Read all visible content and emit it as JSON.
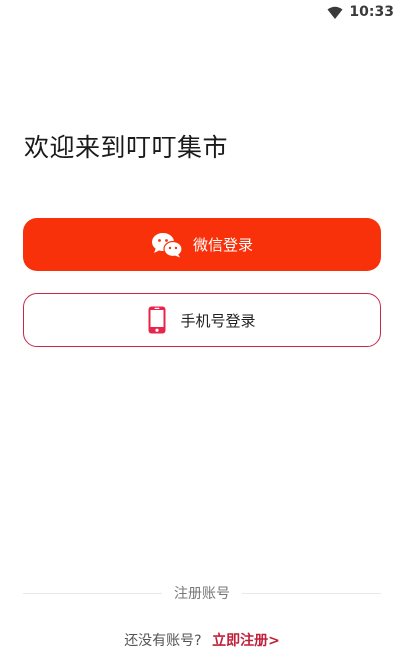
{
  "status_bar": {
    "time": "10:33",
    "wifi_icon": "wifi-icon"
  },
  "welcome": {
    "title": "欢迎来到叮叮集市"
  },
  "wechat_login": {
    "label": "微信登录",
    "icon": "wechat-icon",
    "color": "#f9310a"
  },
  "phone_login": {
    "label": "手机号登录",
    "icon": "mobile-phone-icon",
    "border_color": "#c82848"
  },
  "divider": {
    "label": "注册账号"
  },
  "footer": {
    "prompt": "还没有账号?",
    "register_label": "立即注册>",
    "register_color": "#c01f3a"
  }
}
